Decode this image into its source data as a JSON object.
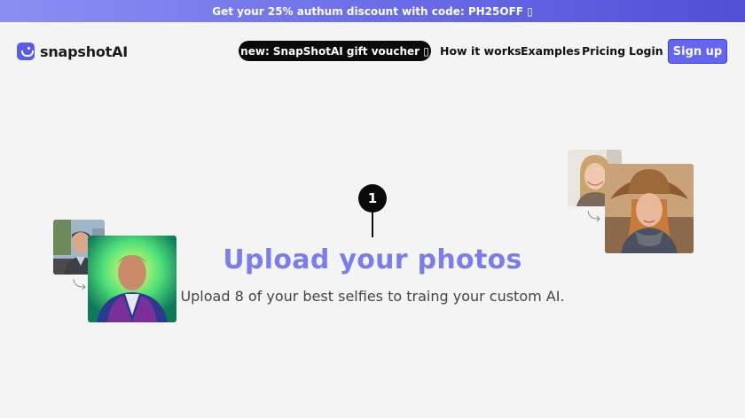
{
  "promo": {
    "text": "Get your 25% authum discount with code: PH25OFF ▯"
  },
  "brand": {
    "name": "snapshotAI"
  },
  "nav": {
    "voucher": "new: SnapShotAI gift voucher ▯",
    "links": [
      "How it works",
      "Examples",
      "Pricing",
      "Login"
    ],
    "signup": "Sign up"
  },
  "hero": {
    "step_number": "1",
    "headline": "Upload your photos",
    "subtitle": "Upload 8 of your best selfies to traing your custom AI."
  },
  "colors": {
    "accent": "#6366f1",
    "headline": "#7b7ee8",
    "background": "#f4f4f5"
  }
}
